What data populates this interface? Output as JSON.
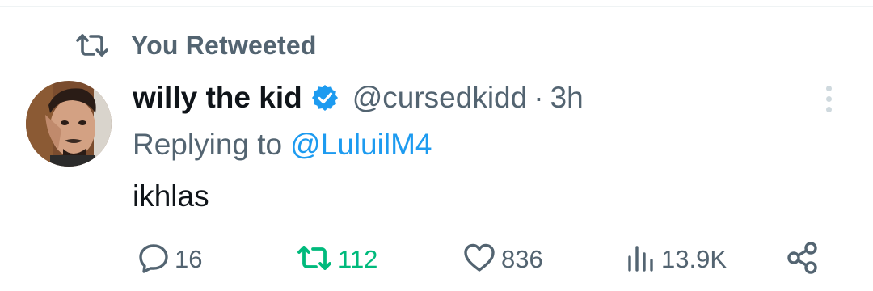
{
  "retweet_context": {
    "label": "You Retweeted"
  },
  "tweet": {
    "author": {
      "display_name": "willy the kid",
      "handle": "@cursedkidd",
      "verified": true
    },
    "separator": "·",
    "time": "3h",
    "replying_to": {
      "prefix": "Replying to",
      "mention": "@LuluilM4"
    },
    "text": "ikhlas"
  },
  "actions": {
    "replies": "16",
    "retweets": "112",
    "likes": "836",
    "views": "13.9K"
  },
  "colors": {
    "accent": "#1d9bf0",
    "retweet_active": "#00ba7c",
    "secondary_text": "#536471",
    "primary_text": "#0f1419"
  },
  "icons": {
    "retweet_context": "retweet-icon",
    "verified": "verified-badge-icon",
    "more": "more-vertical-icon",
    "reply": "reply-icon",
    "retweet": "retweet-icon",
    "like": "heart-icon",
    "views": "views-icon",
    "share": "share-icon"
  }
}
